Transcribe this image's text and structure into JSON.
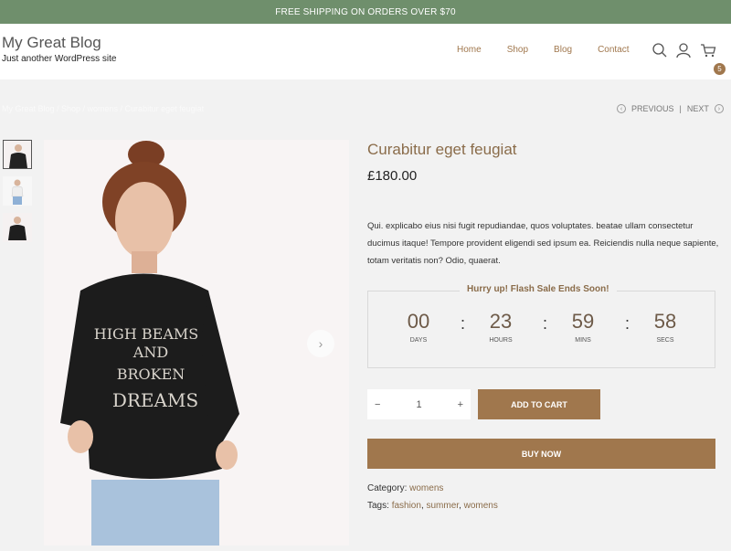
{
  "topbar": {
    "text": "FREE SHIPPING ON ORDERS OVER $70"
  },
  "header": {
    "site_title": "My Great Blog",
    "tagline": "Just another WordPress site",
    "nav": [
      "Home",
      "Shop",
      "Blog",
      "Contact"
    ],
    "cart_count": "5"
  },
  "breadcrumb": {
    "text": "My Great Blog / Shop / womens / Curabitur eget feugiat"
  },
  "prevnext": {
    "previous": "PREVIOUS",
    "separator": "|",
    "next": "NEXT"
  },
  "product": {
    "title": "Curabitur eget feugiat",
    "price": "£180.00",
    "description": "Qui. explicabo eius nisi fugit repudiandae, quos voluptates. beatae ullam consectetur ducimus itaque! Tempore provident eligendi sed ipsum ea. Reiciendis nulla neque sapiente, totam veritatis non? Odio, quaerat.",
    "shirt_text": [
      "HIGH BEAMS",
      "AND",
      "BROKEN",
      "DREAMS"
    ]
  },
  "countdown": {
    "title": "Hurry up! Flash Sale Ends Soon!",
    "days": "00",
    "days_label": "DAYS",
    "hours": "23",
    "hours_label": "HOURS",
    "mins": "59",
    "mins_label": "MINS",
    "secs": "58",
    "secs_label": "SECS",
    "sep": ":"
  },
  "cart": {
    "minus": "−",
    "qty": "1",
    "plus": "+",
    "add_to_cart": "ADD TO CART",
    "buy_now": "BUY NOW"
  },
  "meta": {
    "category_label": "Category:",
    "category": "womens",
    "tags_label": "Tags:",
    "tag1": "fashion",
    "tag2": "summer",
    "tag3": "womens",
    "comma": ","
  },
  "colors": {
    "accent": "#a0774d",
    "topbar": "#6f8f6c",
    "title": "#8a6c4a"
  },
  "icons": [
    "search-icon",
    "user-icon",
    "cart-icon",
    "chevron-left-icon",
    "chevron-right-icon"
  ]
}
